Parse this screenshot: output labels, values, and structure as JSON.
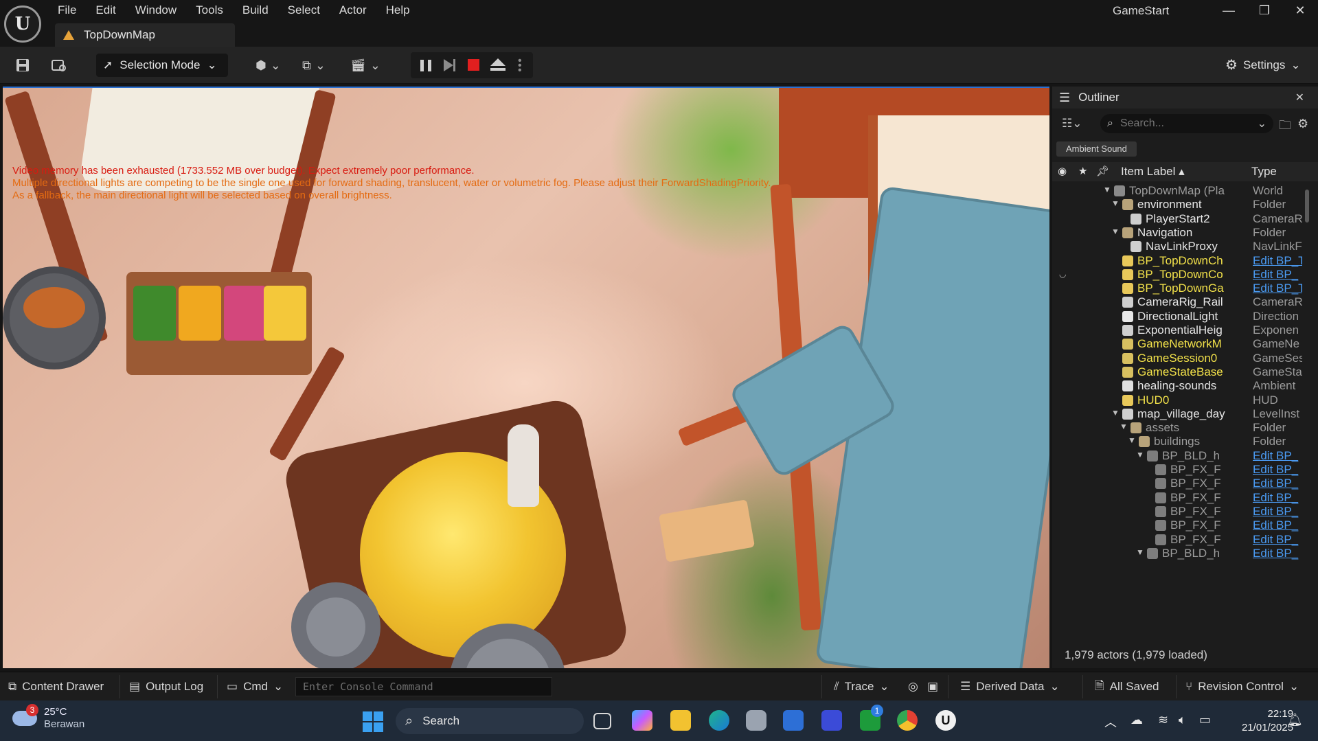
{
  "window": {
    "project_name": "GameStart",
    "map_tab": "TopDownMap"
  },
  "menu": [
    "File",
    "Edit",
    "Window",
    "Tools",
    "Build",
    "Select",
    "Actor",
    "Help"
  ],
  "toolbar": {
    "selection_mode": "Selection Mode",
    "settings": "Settings"
  },
  "viewport": {
    "warnings": [
      {
        "text": "Video memory has been exhausted (1733.552 MB over budget). Expect extremely poor performance.",
        "color": "#d81a10"
      },
      {
        "text": "Multiple directional lights are competing to be the single one used for forward shading, translucent, water or volumetric fog. Please adjust their ForwardShadingPriority.",
        "color": "#e46b12"
      },
      {
        "text": "As a fallback, the main directional light will be selected based on overall brightness.",
        "color": "#e46b12"
      }
    ]
  },
  "outliner": {
    "title": "Outliner",
    "search_placeholder": "Search...",
    "filter_chip": "Ambient Sound",
    "columns": {
      "label": "Item Label",
      "type": "Type"
    },
    "rows": [
      {
        "label": "TopDownMap (Pla",
        "type": "World",
        "depth": 0,
        "arrow": "▼",
        "style": "dim",
        "link": false,
        "icon": "map-icon"
      },
      {
        "label": "environment",
        "type": "Folder",
        "depth": 1,
        "arrow": "▼",
        "style": "normal",
        "link": false,
        "icon": "folder-icon"
      },
      {
        "label": "PlayerStart2",
        "type": "CameraR",
        "depth": 2,
        "arrow": "",
        "style": "normal",
        "link": false,
        "icon": "player-start-icon"
      },
      {
        "label": "Navigation",
        "type": "Folder",
        "depth": 1,
        "arrow": "▼",
        "style": "normal",
        "link": false,
        "icon": "folder-icon"
      },
      {
        "label": "NavLinkProxy",
        "type": "NavLinkF",
        "depth": 2,
        "arrow": "",
        "style": "normal",
        "link": false,
        "icon": "navlink-icon"
      },
      {
        "label": "BP_TopDownCh",
        "type": "Edit BP_T",
        "depth": 1,
        "arrow": "",
        "style": "yellow",
        "link": true,
        "icon": "character-icon"
      },
      {
        "label": "BP_TopDownCo",
        "type": "Edit BP_",
        "depth": 1,
        "arrow": "",
        "style": "yellow",
        "link": true,
        "icon": "controller-icon"
      },
      {
        "label": "BP_TopDownGa",
        "type": "Edit BP_T",
        "depth": 1,
        "arrow": "",
        "style": "yellow",
        "link": true,
        "icon": "gamemode-icon"
      },
      {
        "label": "CameraRig_Rail",
        "type": "CameraR",
        "depth": 1,
        "arrow": "",
        "style": "normal",
        "link": false,
        "icon": "camera-rail-icon"
      },
      {
        "label": "DirectionalLight",
        "type": "Direction",
        "depth": 1,
        "arrow": "",
        "style": "normal",
        "link": false,
        "icon": "sun-icon"
      },
      {
        "label": "ExponentialHeig",
        "type": "Exponen",
        "depth": 1,
        "arrow": "",
        "style": "normal",
        "link": false,
        "icon": "fog-icon"
      },
      {
        "label": "GameNetworkM",
        "type": "GameNe",
        "depth": 1,
        "arrow": "",
        "style": "yellow",
        "link": false,
        "icon": "actor-icon"
      },
      {
        "label": "GameSession0",
        "type": "GameSes",
        "depth": 1,
        "arrow": "",
        "style": "yellow",
        "link": false,
        "icon": "actor-icon"
      },
      {
        "label": "GameStateBase",
        "type": "GameSta",
        "depth": 1,
        "arrow": "",
        "style": "yellow",
        "link": false,
        "icon": "gamestate-icon"
      },
      {
        "label": "healing-sounds",
        "type": "Ambient",
        "depth": 1,
        "arrow": "",
        "style": "normal",
        "link": false,
        "icon": "speaker-icon"
      },
      {
        "label": "HUD0",
        "type": "HUD",
        "depth": 1,
        "arrow": "",
        "style": "yellow",
        "link": false,
        "icon": "hud-icon"
      },
      {
        "label": "map_village_day",
        "type": "LevelInst",
        "depth": 1,
        "arrow": "▼",
        "style": "normal",
        "link": false,
        "icon": "level-instance-icon"
      },
      {
        "label": "assets",
        "type": "Folder",
        "depth": 2,
        "arrow": "▼",
        "style": "dim",
        "link": false,
        "icon": "folder-icon"
      },
      {
        "label": "buildings",
        "type": "Folder",
        "depth": 3,
        "arrow": "▼",
        "style": "dim",
        "link": false,
        "icon": "folder-icon"
      },
      {
        "label": "BP_BLD_h",
        "type": "Edit BP_",
        "depth": 4,
        "arrow": "▼",
        "style": "dim",
        "link": true,
        "icon": "blueprint-icon"
      },
      {
        "label": "BP_FX_F",
        "type": "Edit BP_",
        "depth": 5,
        "arrow": "",
        "style": "dim",
        "link": true,
        "icon": "blueprint-icon"
      },
      {
        "label": "BP_FX_F",
        "type": "Edit BP_",
        "depth": 5,
        "arrow": "",
        "style": "dim",
        "link": true,
        "icon": "blueprint-icon"
      },
      {
        "label": "BP_FX_F",
        "type": "Edit BP_",
        "depth": 5,
        "arrow": "",
        "style": "dim",
        "link": true,
        "icon": "blueprint-icon"
      },
      {
        "label": "BP_FX_F",
        "type": "Edit BP_",
        "depth": 5,
        "arrow": "",
        "style": "dim",
        "link": true,
        "icon": "blueprint-icon"
      },
      {
        "label": "BP_FX_F",
        "type": "Edit BP_",
        "depth": 5,
        "arrow": "",
        "style": "dim",
        "link": true,
        "icon": "blueprint-icon"
      },
      {
        "label": "BP_FX_F",
        "type": "Edit BP_",
        "depth": 5,
        "arrow": "",
        "style": "dim",
        "link": true,
        "icon": "blueprint-icon"
      },
      {
        "label": "BP_BLD_h",
        "type": "Edit BP_",
        "depth": 4,
        "arrow": "▼",
        "style": "dim",
        "link": true,
        "icon": "blueprint-icon"
      }
    ],
    "footer": "1,979 actors (1,979 loaded)"
  },
  "statusbar": {
    "content_drawer": "Content Drawer",
    "output_log": "Output Log",
    "cmd": "Cmd",
    "console_placeholder": "Enter Console Command",
    "trace": "Trace",
    "derived_data": "Derived Data",
    "all_saved": "All Saved",
    "revision_control": "Revision Control"
  },
  "taskbar": {
    "weather_temp": "25°C",
    "weather_desc": "Berawan",
    "weather_badge": "3",
    "search": "Search",
    "xbox_badge": "1",
    "time": "22:19",
    "date": "21/01/2025"
  }
}
